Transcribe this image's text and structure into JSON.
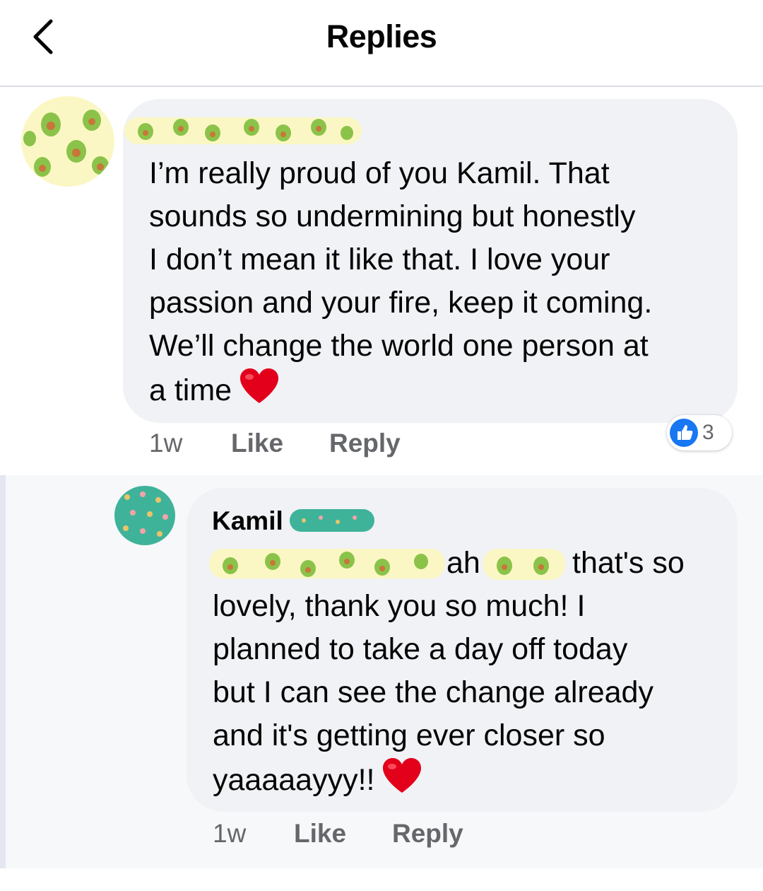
{
  "header": {
    "title": "Replies"
  },
  "comments": [
    {
      "text_lines": [
        "I’m really proud of you Kamil. That",
        "sounds so undermining but honestly",
        "I don’t mean it like that. I love your",
        "passion and your fire, keep it coming.",
        "We’ll change the world one person at",
        "a time"
      ],
      "time": "1w",
      "like_label": "Like",
      "reply_label": "Reply",
      "reaction_count": "3"
    },
    {
      "author": "Kamil",
      "text_lines": [
        "ah",
        "that's so",
        "lovely, thank you so much! I",
        "planned to take a day off today",
        "but I can see the change already",
        "and it's getting ever closer so",
        "yaaaaayyy!!"
      ],
      "time": "1w",
      "like_label": "Like",
      "reply_label": "Reply"
    }
  ],
  "colors": {
    "accent": "#1877f2",
    "bubble": "#f0f2f5",
    "muted": "#65676b",
    "heart": "#e3001b"
  }
}
